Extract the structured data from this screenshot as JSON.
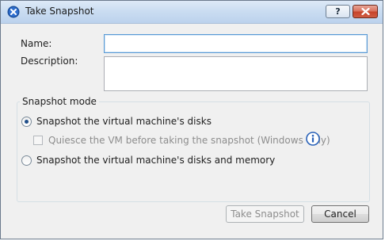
{
  "window": {
    "title": "Take Snapshot",
    "help_label": "?",
    "app_icon": "vsphere-logo-icon",
    "close_icon": "close-icon"
  },
  "form": {
    "name_label": "Name:",
    "name_value": "",
    "description_label": "Description:",
    "description_value": ""
  },
  "snapshot_mode": {
    "title": "Snapshot mode",
    "option_disks": "Snapshot the virtual machine's disks",
    "option_disks_selected": true,
    "quiesce_label": "Quiesce the VM before taking the snapshot (Windows only)",
    "quiesce_checked": false,
    "quiesce_enabled": false,
    "info_icon": "info-icon",
    "option_memory": "Snapshot the virtual machine's disks and memory",
    "option_memory_selected": false
  },
  "buttons": {
    "take_snapshot": "Take Snapshot",
    "take_snapshot_enabled": false,
    "cancel": "Cancel"
  },
  "colors": {
    "titlebar": "#c9dcf1",
    "close_button": "#c7442b",
    "focus_border": "#5b9bd5",
    "radio_dot": "#1f4e8a"
  }
}
